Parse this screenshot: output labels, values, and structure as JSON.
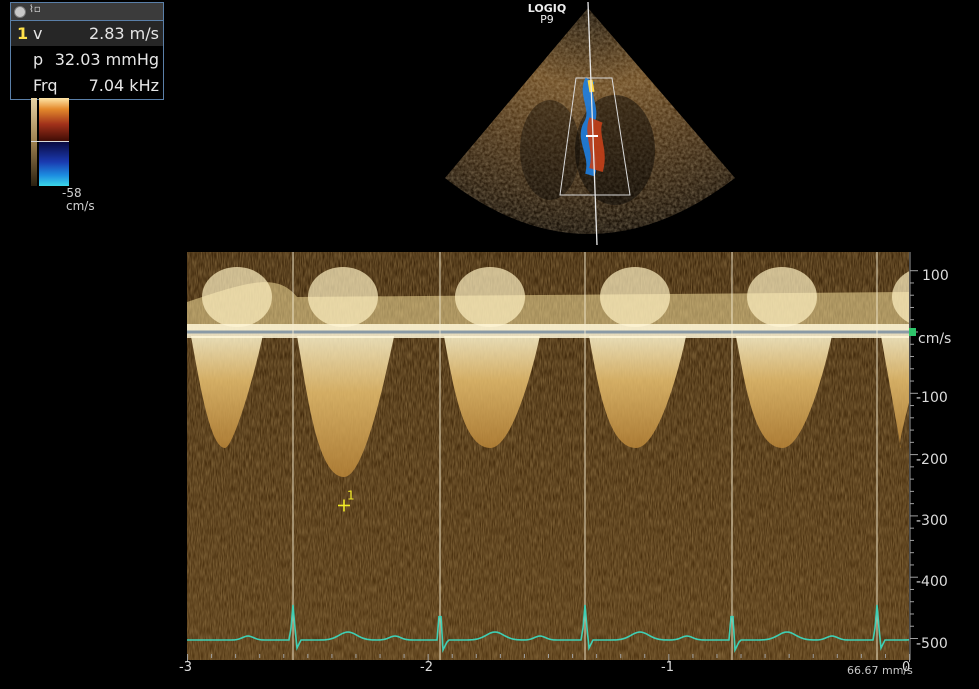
{
  "measurement": {
    "index": "1",
    "rows": [
      {
        "label": "v",
        "value": "2.83 m/s"
      },
      {
        "label": "p",
        "value": "32.03 mmHg"
      },
      {
        "label": "Frq",
        "value": "7.04 kHz"
      }
    ]
  },
  "color_scale": {
    "low_label": "-58",
    "unit": "cm/s"
  },
  "system": {
    "brand": "LOGIQ",
    "model": "P9"
  },
  "doppler": {
    "velocity_unit": "cm/s",
    "velocity_ticks": [
      "100",
      "-100",
      "-200",
      "-300",
      "-400",
      "-500"
    ],
    "time_ticks": [
      "-3",
      "-2",
      "-1",
      "0"
    ],
    "cursor_label": "1",
    "sweep_speed": "66.67 mm/s"
  },
  "colors": {
    "ecg": "#3fcfb4",
    "cursor": "#f2ec27",
    "baseline": "#8a9aa5",
    "marker": "#2ec46a",
    "frame": "#5a7fa8"
  }
}
